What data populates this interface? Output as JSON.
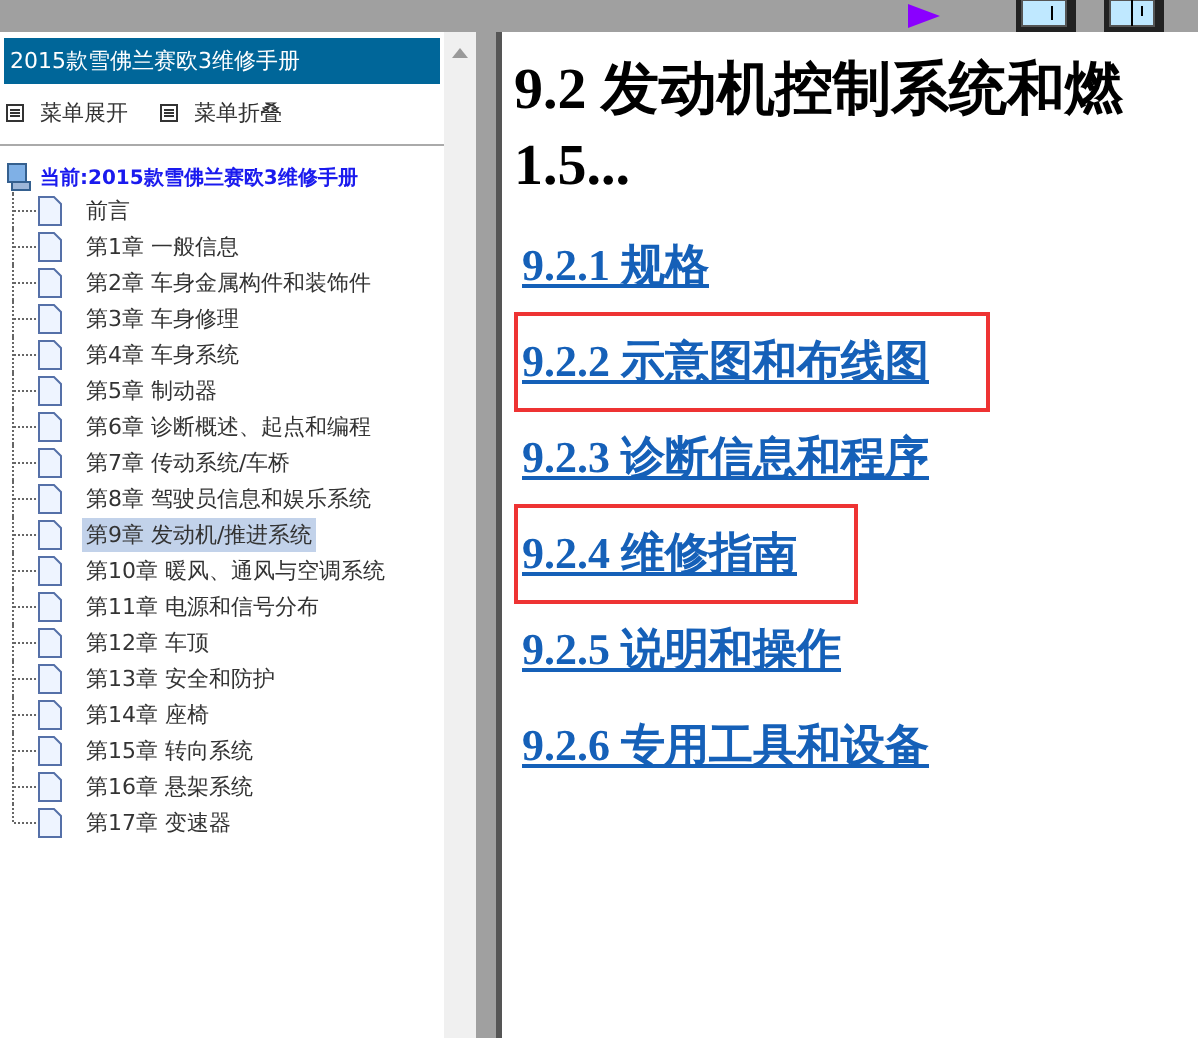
{
  "sidebar": {
    "title": "2015款雪佛兰赛欧3维修手册",
    "actions": [
      {
        "label": "菜单展开"
      },
      {
        "label": "菜单折叠"
      }
    ],
    "tree": {
      "label": "当前:2015款雪佛兰赛欧3维修手册",
      "children": [
        {
          "label": "前言",
          "selected": false
        },
        {
          "label": "第1章 一般信息",
          "selected": false
        },
        {
          "label": "第2章 车身金属构件和装饰件",
          "selected": false
        },
        {
          "label": "第3章 车身修理",
          "selected": false
        },
        {
          "label": "第4章 车身系统",
          "selected": false
        },
        {
          "label": "第5章 制动器",
          "selected": false
        },
        {
          "label": "第6章 诊断概述、起点和编程",
          "selected": false
        },
        {
          "label": "第7章 传动系统/车桥",
          "selected": false
        },
        {
          "label": "第8章 驾驶员信息和娱乐系统",
          "selected": false
        },
        {
          "label": "第9章 发动机/推进系统",
          "selected": true
        },
        {
          "label": "第10章 暖风、通风与空调系统",
          "selected": false
        },
        {
          "label": "第11章 电源和信号分布",
          "selected": false
        },
        {
          "label": "第12章 车顶",
          "selected": false
        },
        {
          "label": "第13章 安全和防护",
          "selected": false
        },
        {
          "label": "第14章 座椅",
          "selected": false
        },
        {
          "label": "第15章 转向系统",
          "selected": false
        },
        {
          "label": "第16章 悬架系统",
          "selected": false
        },
        {
          "label": "第17章 变速器",
          "selected": false
        }
      ]
    }
  },
  "content": {
    "heading": [
      "9.2 发动机控制系统和燃",
      "1.5..."
    ],
    "links": [
      {
        "label": "9.2.1 规格",
        "highlighted": false
      },
      {
        "label": "9.2.2 示意图和布线图",
        "highlighted": true
      },
      {
        "label": "9.2.3 诊断信息和程序",
        "highlighted": false
      },
      {
        "label": "9.2.4 维修指南",
        "highlighted": true
      },
      {
        "label": "9.2.5 说明和操作",
        "highlighted": false
      },
      {
        "label": "9.2.6 专用工具和设备",
        "highlighted": false
      }
    ]
  }
}
